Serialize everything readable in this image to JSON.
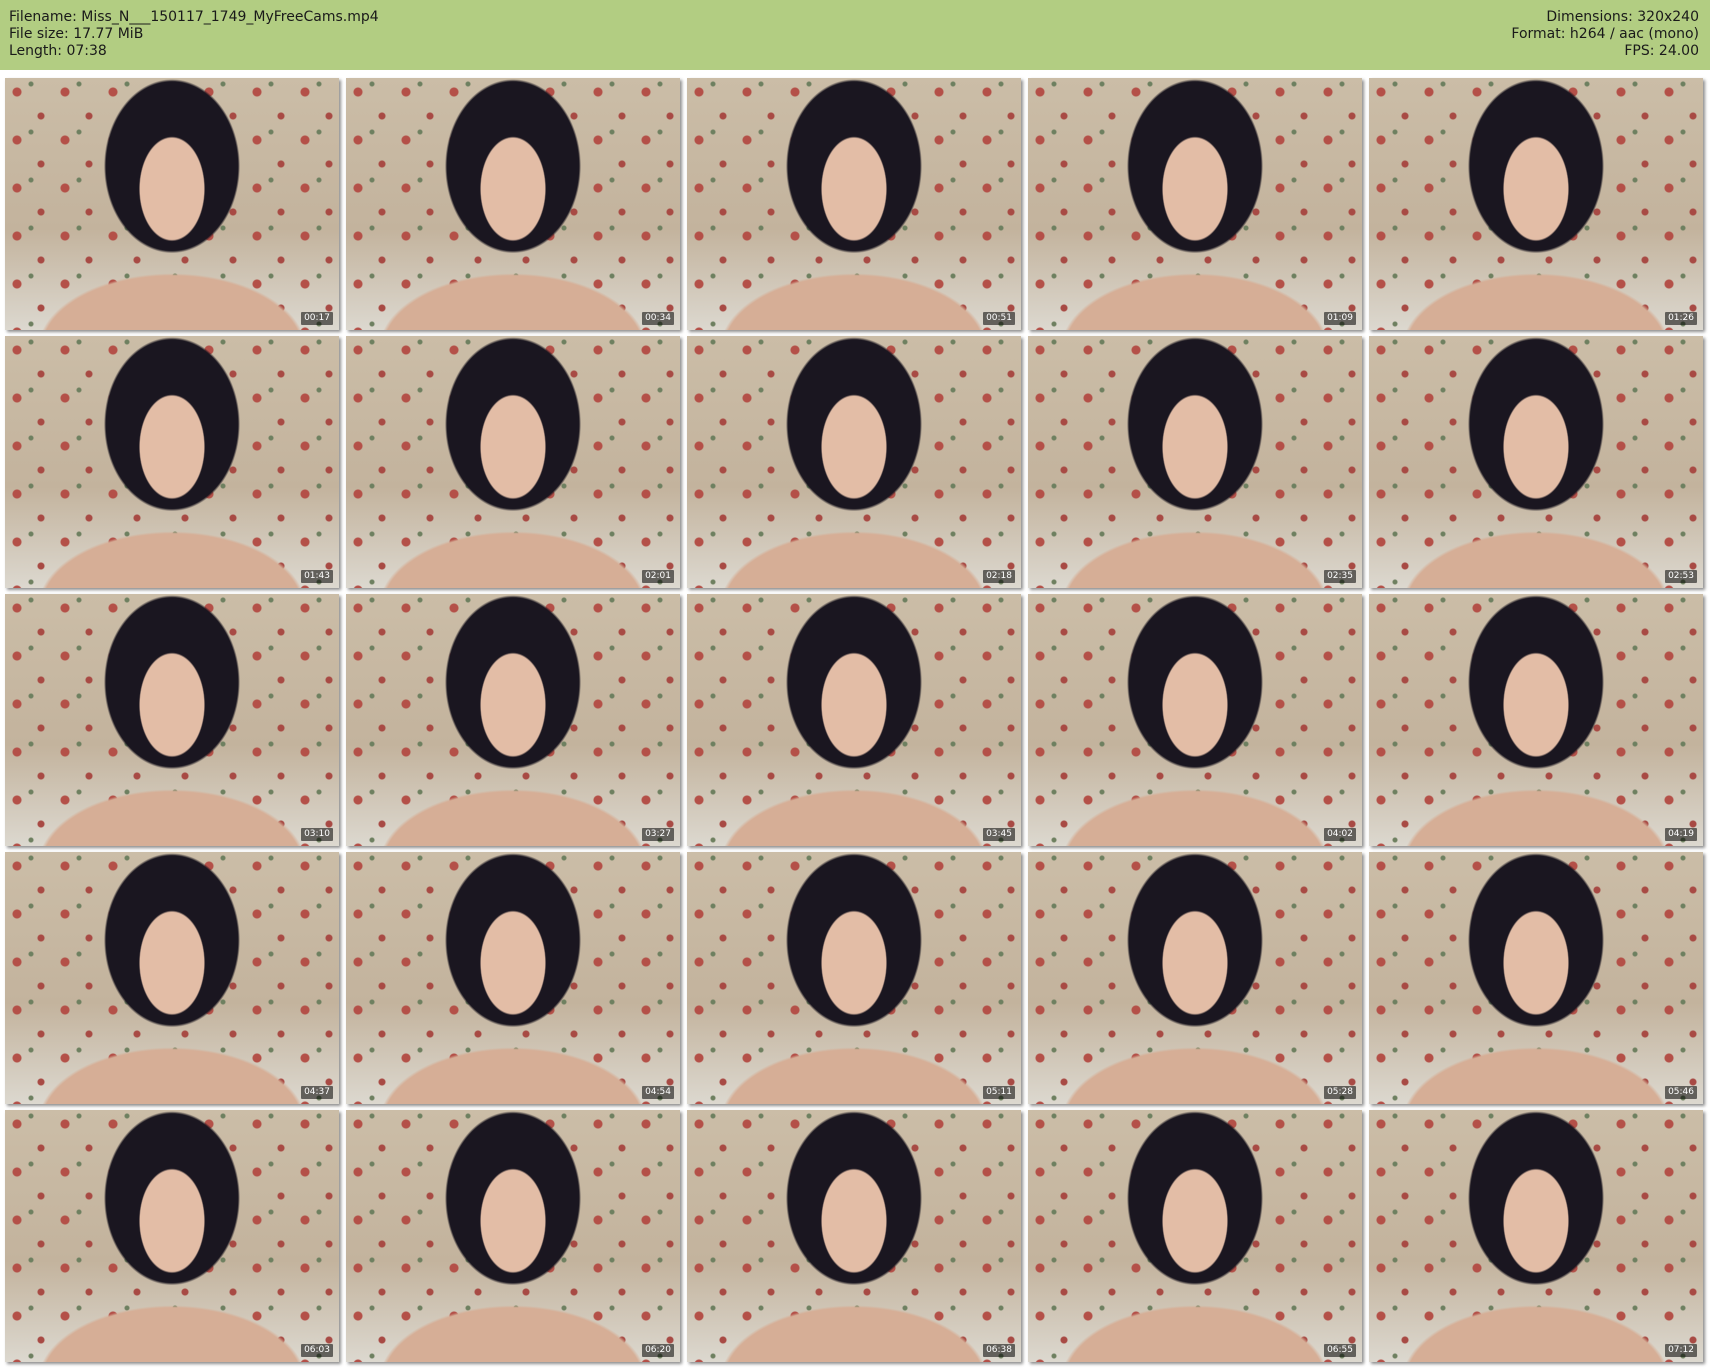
{
  "header": {
    "filename": "Filename: Miss_N___150117_1749_MyFreeCams.mp4",
    "filesize": "File size: 17.77 MiB",
    "length": "Length: 07:38",
    "dimensions": "Dimensions: 320x240",
    "format": "Format: h264 / aac (mono)",
    "fps": "FPS: 24.00"
  },
  "thumbnails": [
    {
      "timestamp": "00:17"
    },
    {
      "timestamp": "00:34"
    },
    {
      "timestamp": "00:51"
    },
    {
      "timestamp": "01:09"
    },
    {
      "timestamp": "01:26"
    },
    {
      "timestamp": "01:43"
    },
    {
      "timestamp": "02:01"
    },
    {
      "timestamp": "02:18"
    },
    {
      "timestamp": "02:35"
    },
    {
      "timestamp": "02:53"
    },
    {
      "timestamp": "03:10"
    },
    {
      "timestamp": "03:27"
    },
    {
      "timestamp": "03:45"
    },
    {
      "timestamp": "04:02"
    },
    {
      "timestamp": "04:19"
    },
    {
      "timestamp": "04:37"
    },
    {
      "timestamp": "04:54"
    },
    {
      "timestamp": "05:11"
    },
    {
      "timestamp": "05:28"
    },
    {
      "timestamp": "05:46"
    },
    {
      "timestamp": "06:03"
    },
    {
      "timestamp": "06:20"
    },
    {
      "timestamp": "06:38"
    },
    {
      "timestamp": "06:55"
    },
    {
      "timestamp": "07:12"
    }
  ]
}
